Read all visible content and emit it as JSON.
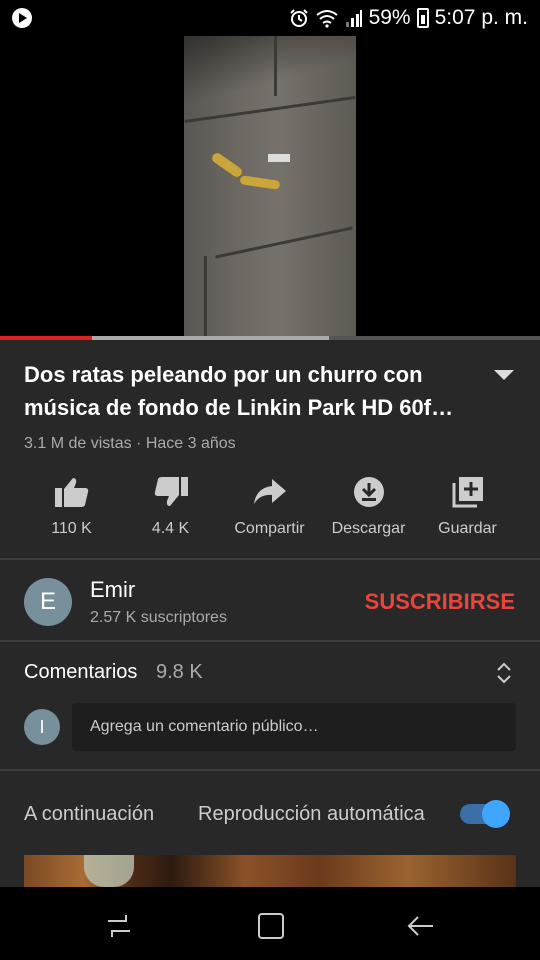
{
  "status_bar": {
    "battery": "59%",
    "time": "5:07 p. m."
  },
  "player": {
    "progress_played": 0.17,
    "progress_buffered": 0.61
  },
  "video": {
    "title_line1": "Dos ratas peleando por un churro con",
    "title_line2": "música de fondo de Linkin Park HD 60f…",
    "meta": "3.1 M de vistas · Hace 3 años"
  },
  "actions": {
    "like": "110 K",
    "dislike": "4.4 K",
    "share": "Compartir",
    "download": "Descargar",
    "save": "Guardar"
  },
  "channel": {
    "avatar_letter": "E",
    "name": "Emir",
    "subscribers": "2.57 K suscriptores",
    "subscribe_label": "SUSCRIBIRSE"
  },
  "comments": {
    "title": "Comentarios",
    "count": "9.8 K",
    "user_avatar_letter": "I",
    "placeholder": "Agrega un comentario público…"
  },
  "up_next": {
    "label": "A continuación",
    "autoplay_label": "Reproducción automática",
    "autoplay_on": true
  },
  "colors": {
    "background": "#282828",
    "subscribe": "#e8453c",
    "progress": "#e0201e",
    "toggle": "#3ea6ff"
  },
  "icons": [
    "play-circle-icon",
    "alarm-icon",
    "wifi-icon",
    "signal-icon",
    "battery-icon",
    "thumbs-up-icon",
    "thumbs-down-icon",
    "share-icon",
    "download-icon",
    "add-to-playlist-icon",
    "expand-chevron-icon",
    "sort-icon",
    "recents-icon",
    "home-icon",
    "back-icon"
  ]
}
